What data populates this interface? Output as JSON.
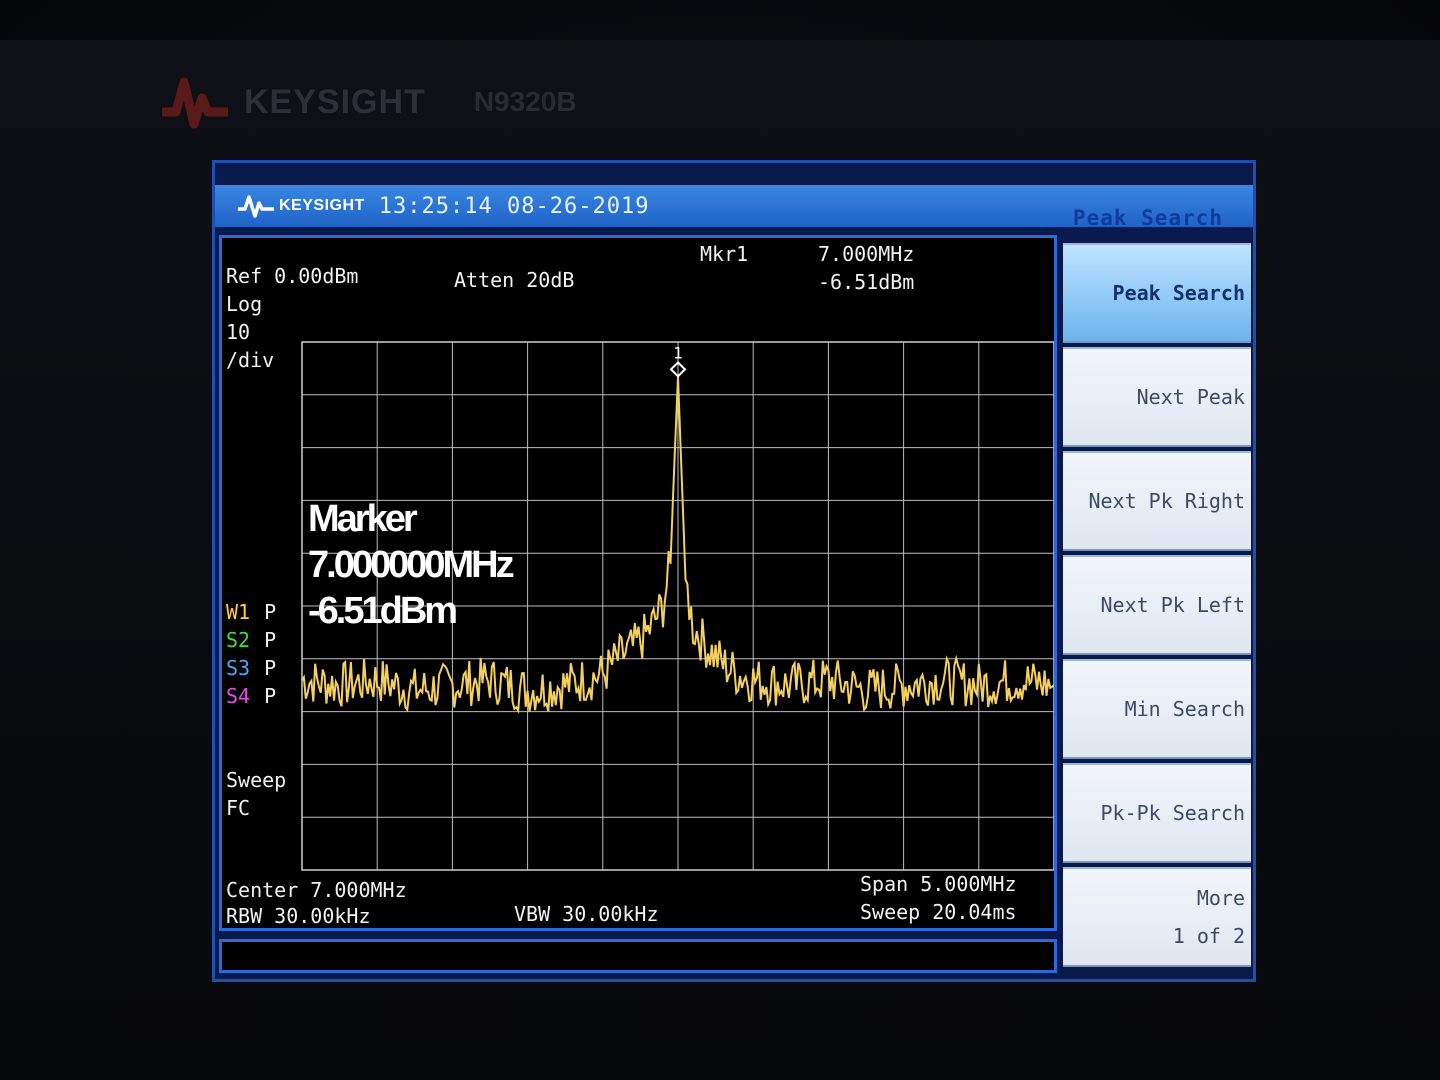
{
  "instrument": {
    "brand": "KEYSIGHT",
    "model": "N9320B"
  },
  "titlebar": {
    "brand": "KEYSIGHT",
    "datetime": "13:25:14 08-26-2019"
  },
  "settings": {
    "ref": "Ref 0.00dBm",
    "scale_1": "Log",
    "scale_2": "10",
    "scale_3": "/div",
    "atten": "Atten 20dB",
    "sweep_1": "Sweep",
    "sweep_2": "FC",
    "center": "Center 7.000MHz",
    "rbw": "RBW 30.00kHz",
    "vbw": "VBW 30.00kHz",
    "span": "Span 5.000MHz",
    "sweep_time": "Sweep 20.04ms"
  },
  "marker": {
    "label": "Mkr1",
    "freq": "7.000MHz",
    "amp": "-6.51dBm",
    "number": "1",
    "overlay_1": "Marker",
    "overlay_2": "7.000000MHz",
    "overlay_3": "-6.51dBm"
  },
  "traces": [
    {
      "name": "W1",
      "mode": "P",
      "color": "#ffd040"
    },
    {
      "name": "S2",
      "mode": "P",
      "color": "#40e040"
    },
    {
      "name": "S3",
      "mode": "P",
      "color": "#4aa8ff"
    },
    {
      "name": "S4",
      "mode": "P",
      "color": "#e050e0"
    }
  ],
  "softkeys": {
    "menu_title": "Peak Search",
    "items": [
      {
        "label": "Peak Search",
        "active": true
      },
      {
        "label": "Next Peak"
      },
      {
        "label": "Next Pk Right"
      },
      {
        "label": "Next Pk Left"
      },
      {
        "label": "Min Search"
      },
      {
        "label": "Pk-Pk Search"
      },
      {
        "label": "More",
        "sub": "1 of 2"
      }
    ]
  },
  "chart_data": {
    "type": "line",
    "x_unit": "MHz",
    "y_unit": "dBm",
    "xlim": [
      4.5,
      9.5
    ],
    "ylim": [
      -100,
      0
    ],
    "y_divisions": 10,
    "x_divisions": 10,
    "grid": true,
    "series": [
      {
        "x": [
          4.5,
          4.75,
          5.0,
          5.25,
          5.5,
          5.75,
          6.0,
          6.25,
          6.5,
          6.6,
          6.7,
          6.8,
          6.9,
          6.95,
          6.98,
          7.0,
          7.02,
          7.05,
          7.1,
          7.2,
          7.3,
          7.4,
          7.5,
          7.75,
          8.0,
          8.25,
          8.5,
          8.75,
          9.0,
          9.25,
          9.5
        ],
        "y": [
          -64,
          -65,
          -64,
          -66,
          -65,
          -64,
          -66,
          -65,
          -63,
          -60,
          -58,
          -55,
          -50,
          -42,
          -20,
          -6.51,
          -22,
          -45,
          -54,
          -58,
          -61,
          -63,
          -64,
          -65,
          -64,
          -66,
          -65,
          -64,
          -65,
          -64,
          -65
        ],
        "color": "#f3d060"
      }
    ]
  }
}
